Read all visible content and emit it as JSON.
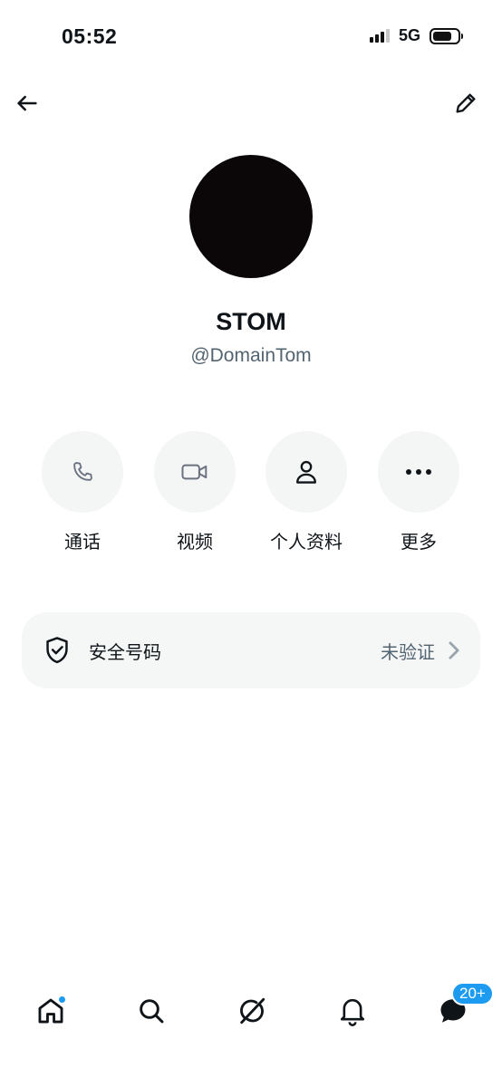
{
  "status_bar": {
    "time": "05:52",
    "network": "5G",
    "battery_level": 0.75
  },
  "nav": {
    "back_icon": "arrow-left-icon",
    "edit_icon": "pencil-icon"
  },
  "profile": {
    "display_name": "STOM",
    "handle": "@DomainTom"
  },
  "actions": [
    {
      "label": "通话",
      "icon": "phone-icon"
    },
    {
      "label": "视频",
      "icon": "video-camera-icon"
    },
    {
      "label": "个人资料",
      "icon": "person-icon"
    },
    {
      "label": "更多",
      "icon": "more-dots-icon"
    }
  ],
  "safety": {
    "label": "安全号码",
    "status": "未验证",
    "icon": "shield-check-icon"
  },
  "tab_bar": {
    "tabs": [
      "home-icon",
      "search-icon",
      "grok-icon",
      "bell-icon",
      "messages-icon"
    ],
    "messages_badge": "20+"
  },
  "colors": {
    "accent": "#1d9bf0",
    "text": "#0f1419",
    "muted": "#536471",
    "surface": "#f4f5f5"
  }
}
